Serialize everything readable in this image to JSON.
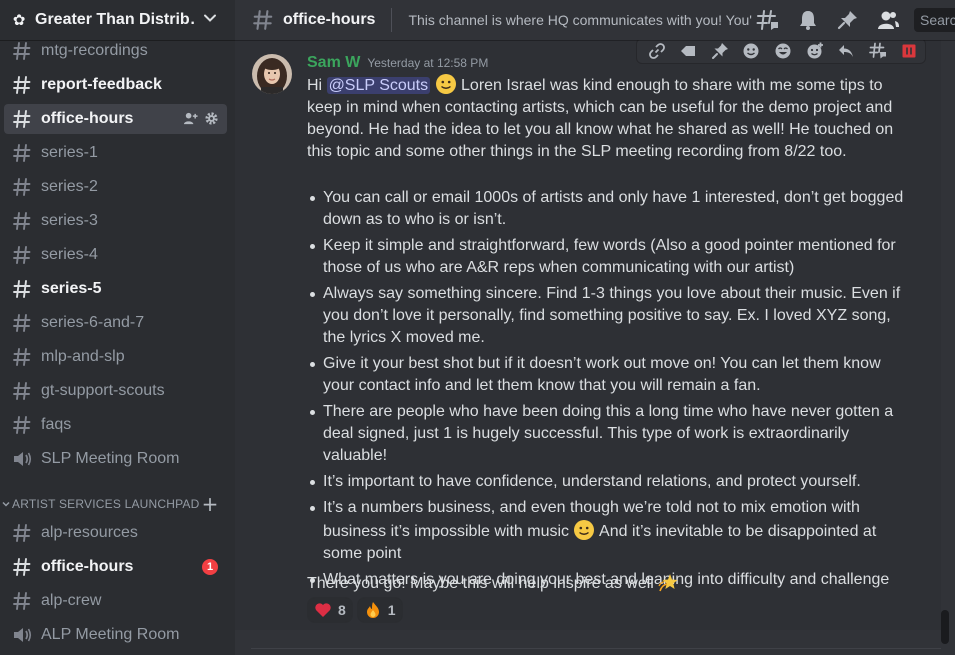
{
  "server": {
    "name": "Greater Than Distrib…"
  },
  "sidebar": {
    "channels_top": [
      {
        "label": "mtg-recordings",
        "type": "text",
        "state": "normal"
      },
      {
        "label": "report-feedback",
        "type": "text",
        "state": "unread"
      },
      {
        "label": "office-hours",
        "type": "text",
        "state": "active"
      },
      {
        "label": "series-1",
        "type": "text",
        "state": "normal"
      },
      {
        "label": "series-2",
        "type": "text",
        "state": "normal"
      },
      {
        "label": "series-3",
        "type": "text",
        "state": "normal"
      },
      {
        "label": "series-4",
        "type": "text",
        "state": "normal"
      },
      {
        "label": "series-5",
        "type": "text",
        "state": "unread"
      },
      {
        "label": "series-6-and-7",
        "type": "text",
        "state": "normal"
      },
      {
        "label": "mlp-and-slp",
        "type": "text",
        "state": "normal"
      },
      {
        "label": "gt-support-scouts",
        "type": "text",
        "state": "normal"
      },
      {
        "label": "faqs",
        "type": "text",
        "state": "normal"
      },
      {
        "label": "SLP Meeting Room",
        "type": "voice",
        "state": "normal"
      }
    ],
    "category": {
      "label": "ARTIST SERVICES LAUNCHPAD"
    },
    "channels_bottom": [
      {
        "label": "alp-resources",
        "type": "text",
        "state": "normal"
      },
      {
        "label": "office-hours",
        "type": "text",
        "state": "unread",
        "badge": "1"
      },
      {
        "label": "alp-crew",
        "type": "text",
        "state": "normal"
      },
      {
        "label": "ALP Meeting Room",
        "type": "voice",
        "state": "normal"
      }
    ]
  },
  "topbar": {
    "channel": "office-hours",
    "topic": "This channel is where HQ communicates with you! You'l...",
    "search_placeholder": "Search"
  },
  "message": {
    "author": "Sam W",
    "timestamp": "Yesterday at 12:58 PM",
    "intro_prefix": "Hi ",
    "mention": "@SLP Scouts",
    "intro_text": " Loren Israel was kind enough to share with me some tips to keep in mind when contacting artists, which can be useful for the demo project and beyond. He had the idea to let you all know what he shared as well! He touched on this topic and some other things in the SLP meeting recording from 8/22 too.",
    "bullets": [
      "You can call or email 1000s of artists and only have 1 interested, don’t get bogged down as to who is or isn’t.",
      "Keep it simple and straightforward, few words (Also a good pointer mentioned for those of us who are A&R reps when communicating with our artist)",
      "Always say something sincere. Find 1-3 things you love about their music. Even if you don’t love it personally, find something positive to say. Ex. I loved XYZ song, the lyrics X moved me.",
      "Give it your best shot but if it doesn’t work out move on! You can let them know your contact info and let them know that you will remain a fan.",
      "There are people who have been doing this a long time who have never gotten a deal signed, just 1 is hugely successful. This type of work is extraordinarily valuable!",
      "It’s important to have confidence, understand relations, and protect yourself."
    ],
    "bullet7_before": "It’s a numbers business, and even though we’re told not to mix emotion with business it’s impossible with music ",
    "bullet7_after": " And it’s inevitable to be disappointed at some point",
    "bullet8": "What matters is you are doing your best and leaning into difficulty and challenge",
    "closing": "There you go! Maybe this will help inspire as well ",
    "reactions": [
      {
        "emoji": "red-heart",
        "count": "8"
      },
      {
        "emoji": "fire",
        "count": "1"
      }
    ]
  },
  "colors": {
    "author": "#3ba55d",
    "mention_bg": "#3c4270",
    "badge": "#f23f43",
    "sidebar_bg": "#2b2d31",
    "chat_bg": "#313338"
  }
}
